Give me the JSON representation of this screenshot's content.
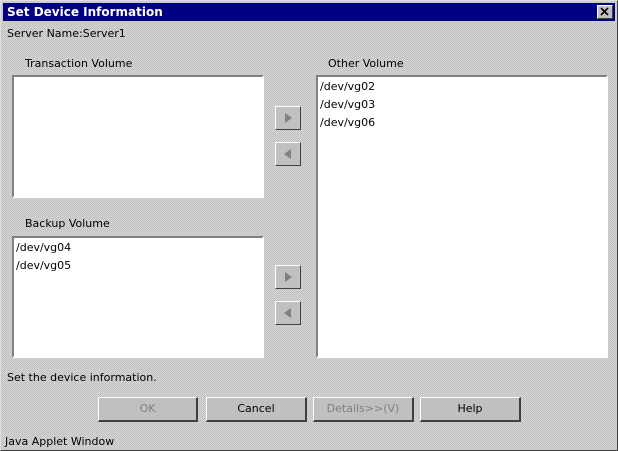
{
  "window": {
    "title": "Set Device Information",
    "server_name": "Server Name:Server1",
    "status_text": "Set the device information.",
    "footer": "Java Applet Window"
  },
  "transaction_volume": {
    "label": "Transaction Volume",
    "items": []
  },
  "backup_volume": {
    "label": "Backup Volume",
    "items": [
      "/dev/vg04",
      "/dev/vg05"
    ]
  },
  "other_volume": {
    "label": "Other Volume",
    "items": [
      "/dev/vg02",
      "/dev/vg03",
      "/dev/vg06"
    ]
  },
  "buttons": {
    "ok": "OK",
    "cancel": "Cancel",
    "details": "Details>>(V)",
    "help": "Help"
  },
  "icons": {
    "close": "close-icon",
    "move_right": "arrow-right-icon",
    "move_left": "arrow-left-icon"
  }
}
